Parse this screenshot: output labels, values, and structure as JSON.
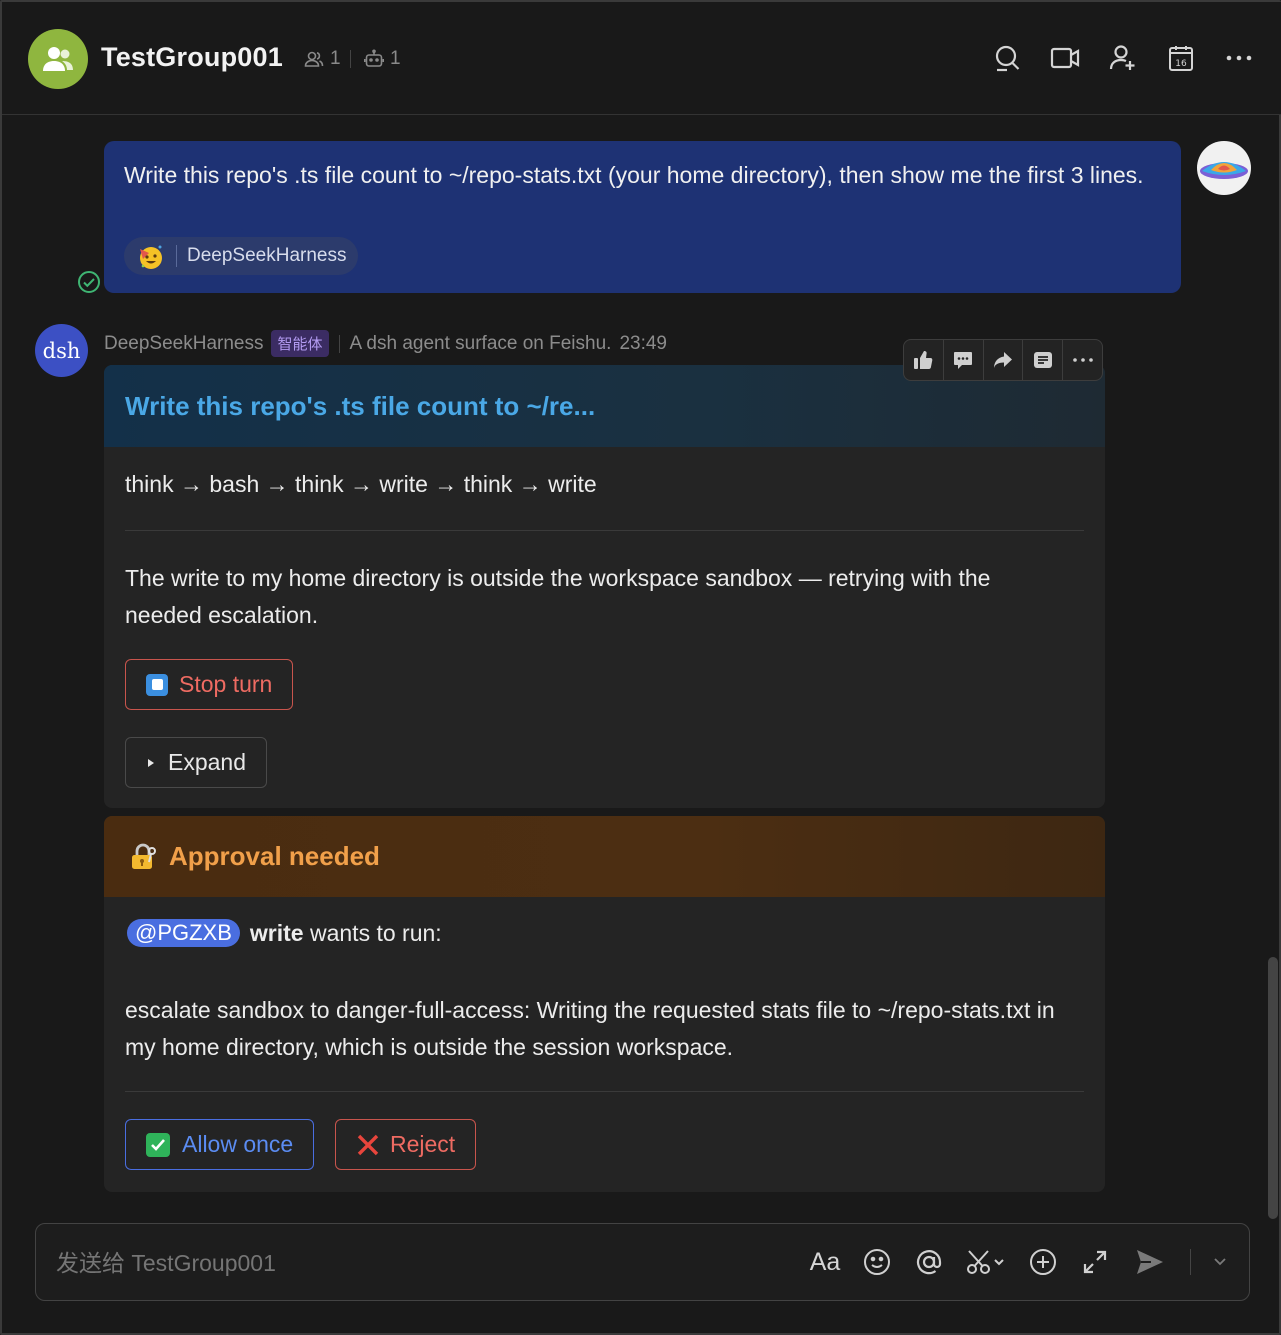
{
  "header": {
    "title": "TestGroup001",
    "member_count": "1",
    "bot_count": "1"
  },
  "user_message": {
    "text": "Write this repo's .ts file count to ~/repo-stats.txt (your home directory), then show me the first 3 lines.",
    "bot_chip_label": "DeepSeekHarness"
  },
  "bot_message": {
    "avatar_text": "dsh",
    "sender": "DeepSeekHarness",
    "badge": "智能体",
    "description": "A dsh agent surface on Feishu.",
    "time": "23:49",
    "card1": {
      "title": "Write this repo's .ts file count to ~/re...",
      "flow": "think → bash → think → write → think → write",
      "status": "The write to my home directory is outside the workspace sandbox — retrying with the needed escalation.",
      "stop_label": "Stop turn",
      "expand_label": "Expand"
    },
    "card2": {
      "title": "Approval needed",
      "mention": "@PGZXB",
      "tool": "write",
      "request_suffix": "wants to run:",
      "detail": "escalate sandbox to danger-full-access: Writing the requested stats file to ~/repo-stats.txt in my home directory, which is outside the session workspace.",
      "allow_label": "Allow once",
      "reject_label": "Reject"
    }
  },
  "composer": {
    "placeholder": "发送给 TestGroup001",
    "font_button": "Aa"
  },
  "colors": {
    "user_bubble": "#1e3274",
    "group_avatar": "#8fb63f",
    "bot_avatar": "#3c50c4",
    "card_title_blue": "#4aa8e6",
    "card_title_orange": "#f1a04a",
    "danger": "#ee6b62",
    "primary": "#5b8cf2"
  }
}
